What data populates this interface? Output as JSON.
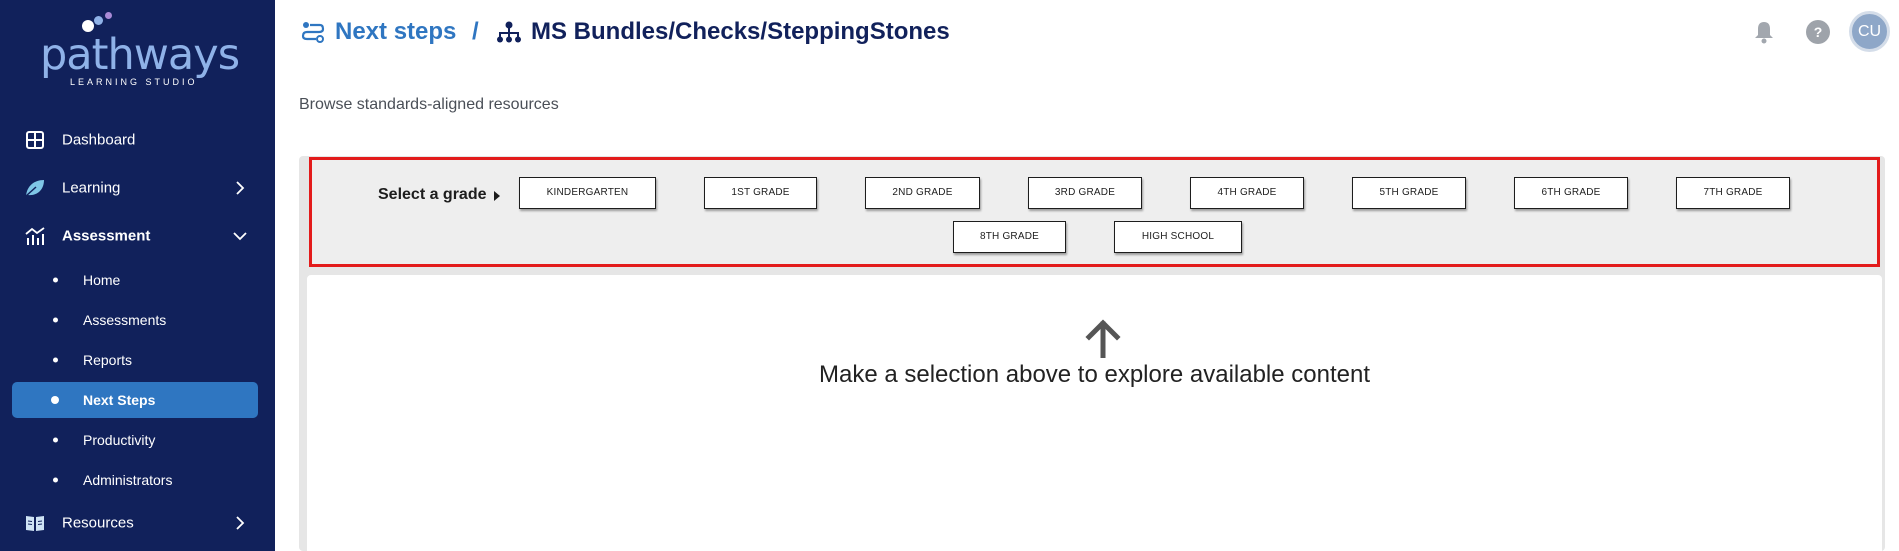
{
  "sidebar": {
    "logo": {
      "word": "pathways",
      "sub": "LEARNING STUDIO"
    },
    "items": [
      {
        "label": "Dashboard",
        "icon": "dashboard-icon"
      },
      {
        "label": "Learning",
        "icon": "leaf-icon",
        "expandable": true
      },
      {
        "label": "Assessment",
        "icon": "chart-icon",
        "expanded": true
      },
      {
        "label": "Resources",
        "icon": "book-icon",
        "expandable": true
      }
    ],
    "assessment_sub": [
      {
        "label": "Home"
      },
      {
        "label": "Assessments"
      },
      {
        "label": "Reports"
      },
      {
        "label": "Next Steps",
        "active": true
      },
      {
        "label": "Productivity"
      },
      {
        "label": "Administrators"
      }
    ]
  },
  "header": {
    "crumb_link": "Next steps",
    "separator": "/",
    "title": "MS Bundles/Checks/SteppingStones",
    "help": "?",
    "avatar": "CU"
  },
  "subtitle": "Browse standards-aligned resources",
  "grades": {
    "label": "Select a grade",
    "options": [
      "KINDERGARTEN",
      "1ST GRADE",
      "2ND GRADE",
      "3RD GRADE",
      "4TH GRADE",
      "5TH GRADE",
      "6TH GRADE",
      "7TH GRADE",
      "8TH GRADE",
      "HIGH SCHOOL"
    ]
  },
  "empty_state": {
    "message": "Make a selection above to explore available content"
  },
  "colors": {
    "sidebar": "#11215b",
    "accent": "#2f76c1",
    "highlight": "#e31b1b"
  }
}
